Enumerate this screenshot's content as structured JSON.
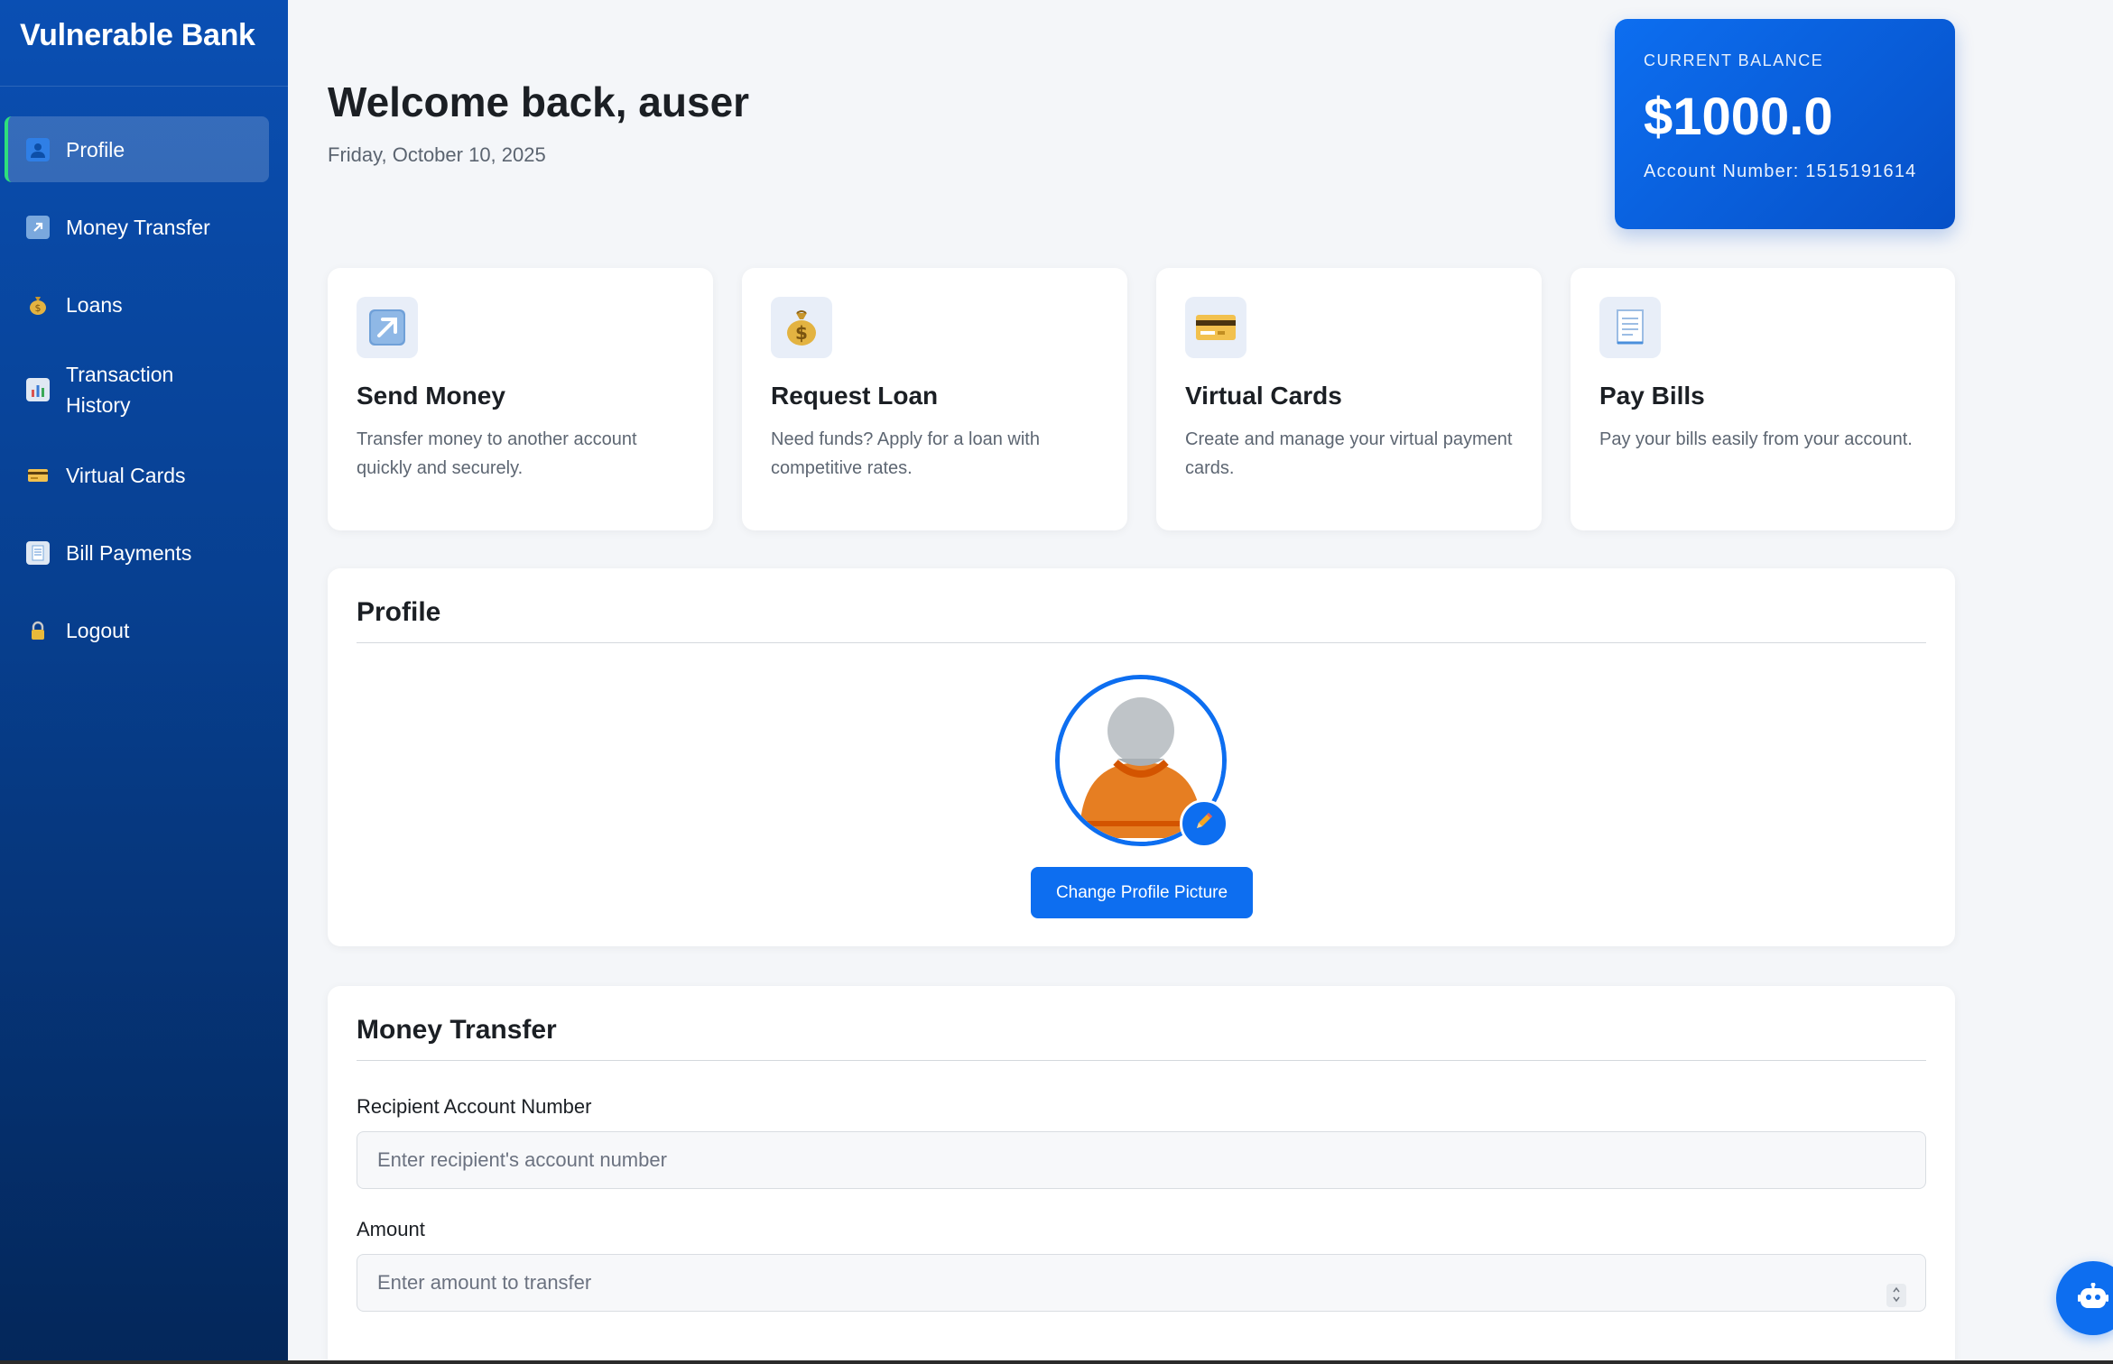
{
  "app": {
    "brand": "Vulnerable Bank"
  },
  "sidebar": {
    "items": [
      {
        "label": "Profile",
        "icon": "person-icon",
        "active": true
      },
      {
        "label": "Money Transfer",
        "icon": "arrow-up-right-icon",
        "active": false
      },
      {
        "label": "Loans",
        "icon": "money-bag-icon",
        "active": false
      },
      {
        "label": "Transaction History",
        "icon": "bar-chart-icon",
        "active": false
      },
      {
        "label": "Virtual Cards",
        "icon": "credit-card-icon",
        "active": false
      },
      {
        "label": "Bill Payments",
        "icon": "receipt-icon",
        "active": false
      },
      {
        "label": "Logout",
        "icon": "lock-icon",
        "active": false
      }
    ]
  },
  "header": {
    "welcome": "Welcome back, auser",
    "date": "Friday, October 10, 2025"
  },
  "balance": {
    "caption": "CURRENT BALANCE",
    "amount": "$1000.0",
    "account": "Account Number: 1515191614"
  },
  "quick_actions": [
    {
      "title": "Send Money",
      "desc": "Transfer money to another account quickly and securely.",
      "icon": "arrow-up-right-icon"
    },
    {
      "title": "Request Loan",
      "desc": "Need funds? Apply for a loan with competitive rates.",
      "icon": "money-bag-icon"
    },
    {
      "title": "Virtual Cards",
      "desc": "Create and manage your virtual payment cards.",
      "icon": "credit-card-icon"
    },
    {
      "title": "Pay Bills",
      "desc": "Pay your bills easily from your account.",
      "icon": "receipt-icon"
    }
  ],
  "profile": {
    "title": "Profile",
    "change_button": "Change Profile Picture"
  },
  "transfer": {
    "title": "Money Transfer",
    "recipient_label": "Recipient Account Number",
    "recipient_placeholder": "Enter recipient's account number",
    "amount_label": "Amount",
    "amount_placeholder": "Enter amount to transfer"
  },
  "colors": {
    "accent": "#0d6ef0",
    "sidebar": "#0a4fb3",
    "active_marker": "#2ee07c"
  }
}
